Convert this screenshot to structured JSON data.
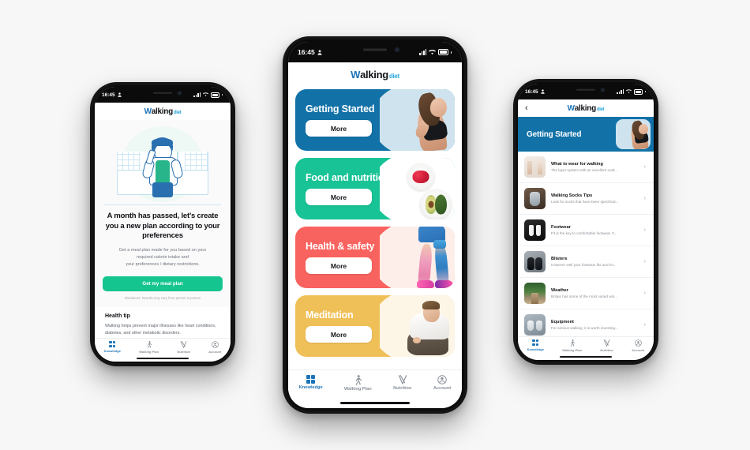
{
  "brand": {
    "logo_mark": "W",
    "logo_main": "alking",
    "logo_sub": "diet",
    "blue": "#1272a8",
    "green": "#18c396",
    "red": "#f9635f",
    "yellow": "#f0c058",
    "cta_green": "#15c58f"
  },
  "status_bar": {
    "time": "16:45",
    "location_icon": "location-icon"
  },
  "nav": {
    "items": [
      {
        "label": "Knowledge",
        "icon": "grid-icon",
        "active": true
      },
      {
        "label": "Walking Plan",
        "icon": "walking-person-icon",
        "active": false
      },
      {
        "label": "Nutrition",
        "icon": "fork-knife-icon",
        "active": false
      },
      {
        "label": "Account",
        "icon": "account-person-icon",
        "active": false
      }
    ]
  },
  "center_phone": {
    "screen_name": "Knowledge categories",
    "cards": [
      {
        "title": "Getting Started",
        "button": "More",
        "color": "#1272a8",
        "art": "runner-photo"
      },
      {
        "title": "Food and nutrition",
        "button": "More",
        "color": "#18c396",
        "art": "raspberries-avocado-photo"
      },
      {
        "title": "Health & safety",
        "button": "More",
        "color": "#f9635f",
        "art": "legs-knee-brace-photo"
      },
      {
        "title": "Meditation",
        "button": "More",
        "color": "#f0c058",
        "art": "meditating-man-photo"
      }
    ]
  },
  "left_phone": {
    "screen_name": "Meal plan prompt",
    "illustration": "woman-cooking-illustration",
    "heading": "A month has passed, let's create you a new plan according to your preferences",
    "subtext_lines": [
      "Get a meal plan made for you based on your",
      "required calorie intake and",
      "your preferences / dietary restrictions."
    ],
    "cta_label": "Get my meal plan",
    "disclaimer": "Disclaimer: Results may vary from person to person",
    "tip_title": "Health tip",
    "tip_text": "Walking helps prevent major illnesses like heart conditions, diabetes, and other metabolic disorders."
  },
  "right_phone": {
    "screen_name": "Getting Started articles",
    "back_icon": "chevron-left-icon",
    "banner_title": "Getting Started",
    "articles": [
      {
        "title": "What to wear for walking",
        "desc": "The layer system with an excellent outd...",
        "thumb": "clothing-layers-thumb",
        "chevron": "chevron-right-icon"
      },
      {
        "title": "Walking Socks Tips",
        "desc": "Look for socks that have been specifical...",
        "thumb": "socks-thumb",
        "chevron": "chevron-right-icon"
      },
      {
        "title": "Footwear",
        "desc": "Fit is the key to comfortable footwear. F...",
        "thumb": "footwear-thumb",
        "chevron": "chevron-right-icon"
      },
      {
        "title": "Blisters",
        "desc": "However well your footwear fits and ho...",
        "thumb": "blisters-boots-thumb",
        "chevron": "chevron-right-icon"
      },
      {
        "title": "Weather",
        "desc": "Britain has some of the most varied wol...",
        "thumb": "weather-path-thumb",
        "chevron": "chevron-right-icon"
      },
      {
        "title": "Equipment",
        "desc": "For serious walking, it is worth investing...",
        "thumb": "equipment-shoes-thumb",
        "chevron": "chevron-right-icon"
      }
    ]
  }
}
